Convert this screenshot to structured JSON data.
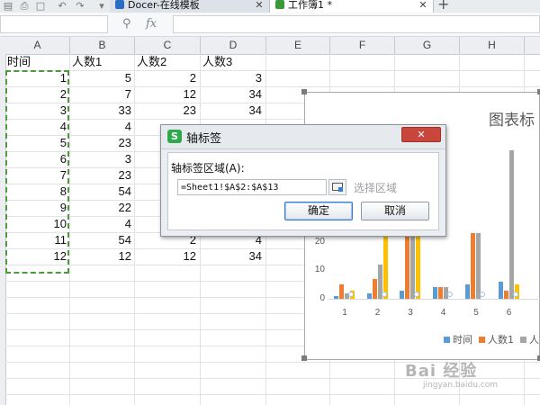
{
  "tabs": [
    {
      "label": "Docer-在线模板",
      "icon_color": "#2b6cc4"
    },
    {
      "label": "工作簿1 *",
      "icon_color": "#3a9a3a"
    }
  ],
  "formula_bar": {
    "name_box_value": "",
    "fx_label": "fx",
    "formula_value": ""
  },
  "columns": [
    "A",
    "B",
    "C",
    "D",
    "E",
    "F",
    "G",
    "H"
  ],
  "sheet": {
    "headers": [
      "时间",
      "人数1",
      "人数2",
      "人数3"
    ],
    "rows": [
      [
        "1",
        "5",
        "2",
        "3"
      ],
      [
        "2",
        "7",
        "12",
        "34"
      ],
      [
        "3",
        "33",
        "23",
        "34"
      ],
      [
        "4",
        "4",
        "",
        ""
      ],
      [
        "5",
        "23",
        "",
        ""
      ],
      [
        "6",
        "3",
        "",
        ""
      ],
      [
        "7",
        "23",
        "",
        ""
      ],
      [
        "8",
        "54",
        "",
        ""
      ],
      [
        "9",
        "22",
        "",
        ""
      ],
      [
        "10",
        "4",
        "",
        ""
      ],
      [
        "11",
        "54",
        "2",
        "4"
      ],
      [
        "12",
        "12",
        "12",
        "34"
      ]
    ]
  },
  "chart_data": {
    "type": "bar",
    "title": "图表标",
    "xlabel": "",
    "ylabel": "",
    "ylim": [
      0,
      60
    ],
    "yticks_visible": [
      "0",
      "10",
      "20"
    ],
    "categories": [
      "1",
      "2",
      "3",
      "4",
      "5",
      "6"
    ],
    "series": [
      {
        "name": "时间",
        "values": [
          1,
          2,
          3,
          4,
          5,
          6
        ],
        "color": "#5b9bd5"
      },
      {
        "name": "人数1",
        "values": [
          5,
          7,
          33,
          4,
          23,
          3
        ],
        "color": "#ed7d31"
      },
      {
        "name": "人",
        "values": [
          2,
          12,
          23,
          4,
          23,
          52
        ],
        "color": "#a5a5a5"
      },
      {
        "name": "",
        "values": [
          3,
          34,
          34,
          0,
          0,
          5
        ],
        "color": "#ffc000"
      }
    ],
    "legend_position": "bottom"
  },
  "dialog": {
    "title": "轴标签",
    "range_label": "轴标签区域(A):",
    "range_value": "=Sheet1!$A$2:$A$13",
    "select_range_label": "选择区域",
    "ok_label": "确定",
    "cancel_label": "取消"
  },
  "watermark": {
    "text": "Bai 经验",
    "sub": "jingyan.baidu.com"
  },
  "colors": {
    "accent": "#3d7fd0",
    "marquee": "#4c9a3c",
    "close": "#c8463b",
    "logo": "#2eaa4c"
  }
}
